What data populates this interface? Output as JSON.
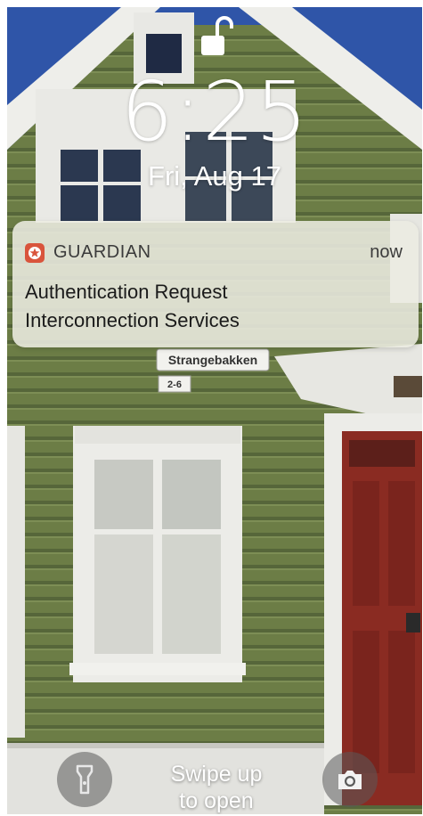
{
  "lockscreen": {
    "lock_state_icon": "unlocked-padlock-icon",
    "time": "6:25",
    "date": "Fri, Aug 17"
  },
  "notification": {
    "app_icon": "star-badge-icon",
    "app_name": "GUARDIAN",
    "time": "now",
    "title": "Authentication Request",
    "body": "Interconnection Services"
  },
  "wallpaper": {
    "sign_street": "Strangebakken",
    "sign_number": "2-6"
  },
  "bottom_bar": {
    "flashlight_icon": "flashlight-icon",
    "swipe_line1": "Swipe up",
    "swipe_line2": "to open",
    "camera_icon": "camera-icon"
  },
  "colors": {
    "siding": "#6b7c45",
    "trim": "#eeeeea",
    "door": "#8a2b22",
    "sky": "#2f55a8",
    "app_icon": "#d9543c"
  }
}
